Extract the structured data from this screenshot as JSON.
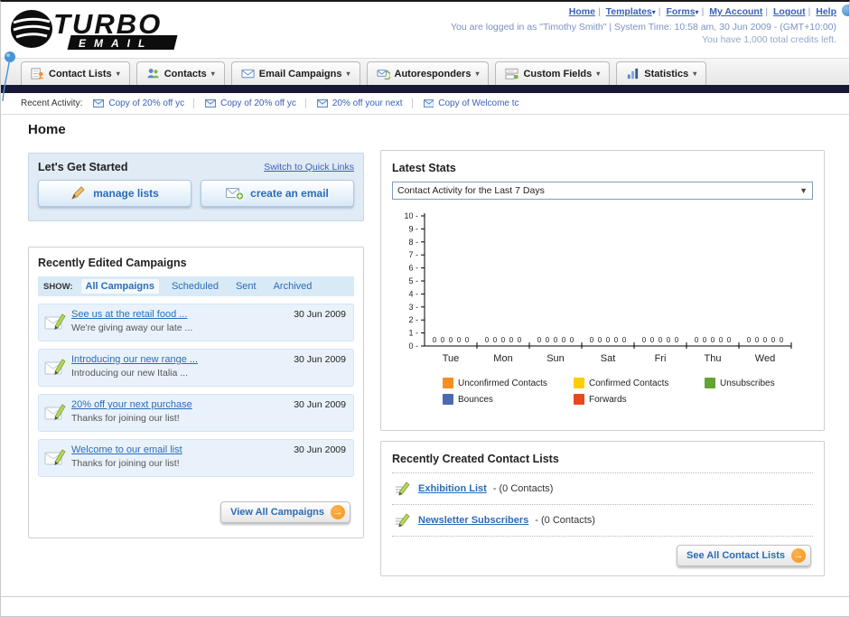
{
  "page": {
    "title": "Home"
  },
  "header": {
    "logo_top": "TURBO",
    "logo_bottom": "EMAIL",
    "nav": [
      {
        "label": "Home",
        "dropdown": false
      },
      {
        "label": "Templates",
        "dropdown": true
      },
      {
        "label": "Forms",
        "dropdown": true
      },
      {
        "label": "My Account",
        "dropdown": false
      },
      {
        "label": "Logout",
        "dropdown": false
      },
      {
        "label": "Help",
        "dropdown": false
      }
    ],
    "login_info": "You are logged in as \"Timothy Smith\" | System Time: 10:58 am, 30 Jun 2009 - (GMT+10:00)",
    "credits": "You have 1,000 total credits left."
  },
  "nav_tabs": [
    {
      "label": "Contact Lists"
    },
    {
      "label": "Contacts"
    },
    {
      "label": "Email Campaigns"
    },
    {
      "label": "Autoresponders"
    },
    {
      "label": "Custom Fields"
    },
    {
      "label": "Statistics"
    }
  ],
  "recent_activity": {
    "label": "Recent Activity:",
    "items": [
      "Copy of 20% off yc",
      "Copy of 20% off yc",
      "20% off your next",
      "Copy of Welcome tc"
    ]
  },
  "get_started": {
    "title": "Let's Get Started",
    "switch_link": "Switch to Quick Links",
    "manage_lists_label": "manage lists",
    "create_email_label": "create an email"
  },
  "campaigns": {
    "title": "Recently Edited Campaigns",
    "show_label": "SHOW:",
    "filters": [
      "All Campaigns",
      "Scheduled",
      "Sent",
      "Archived"
    ],
    "selected_filter": "All Campaigns",
    "items": [
      {
        "title": "See us at the retail food ...",
        "subtitle": "We're giving away our late ...",
        "date": "30 Jun 2009"
      },
      {
        "title": "Introducing our new range ...",
        "subtitle": "Introducing our new Italia ...",
        "date": "30 Jun 2009"
      },
      {
        "title": "20% off your next purchase",
        "subtitle": "Thanks for joining our list!",
        "date": "30 Jun 2009"
      },
      {
        "title": "Welcome to our email list",
        "subtitle": "Thanks for joining our list!",
        "date": "30 Jun 2009"
      }
    ],
    "view_all_label": "View All Campaigns"
  },
  "stats": {
    "title": "Latest Stats",
    "dropdown_value": "Contact Activity for the Last 7 Days",
    "chart_data": {
      "type": "bar",
      "title": "Contact Activity for the Last 7 Days",
      "categories": [
        "Tue",
        "Mon",
        "Sun",
        "Sat",
        "Fri",
        "Thu",
        "Wed"
      ],
      "series": [
        {
          "name": "Unconfirmed Contacts",
          "color": "#f78f1e",
          "values": [
            0,
            0,
            0,
            0,
            0,
            0,
            0
          ]
        },
        {
          "name": "Confirmed Contacts",
          "color": "#ffcc00",
          "values": [
            0,
            0,
            0,
            0,
            0,
            0,
            0
          ]
        },
        {
          "name": "Unsubscribes",
          "color": "#64a433",
          "values": [
            0,
            0,
            0,
            0,
            0,
            0,
            0
          ]
        },
        {
          "name": "Bounces",
          "color": "#4a6baf",
          "values": [
            0,
            0,
            0,
            0,
            0,
            0,
            0
          ]
        },
        {
          "name": "Forwards",
          "color": "#e8471f",
          "values": [
            0,
            0,
            0,
            0,
            0,
            0,
            0
          ]
        }
      ],
      "ylim": [
        0,
        10
      ],
      "ytick_step": 1,
      "grid": false,
      "legend_position": "bottom"
    },
    "legend": [
      {
        "label": "Unconfirmed Contacts",
        "color": "#f78f1e"
      },
      {
        "label": "Confirmed Contacts",
        "color": "#ffcc00"
      },
      {
        "label": "Unsubscribes",
        "color": "#64a433"
      },
      {
        "label": "Bounces",
        "color": "#4a6baf"
      },
      {
        "label": "Forwards",
        "color": "#e8471f"
      }
    ]
  },
  "contact_lists": {
    "title": "Recently Created Contact Lists",
    "items": [
      {
        "name": "Exhibition List",
        "detail": "- (0 Contacts)"
      },
      {
        "name": "Newsletter Subscribers",
        "detail": "- (0 Contacts)"
      }
    ],
    "see_all_label": "See All Contact Lists"
  },
  "colors": {
    "link_blue": "#2a6cb8",
    "accent_orange": "#f7941d",
    "dark_bar": "#181836",
    "panel_blue_bg": "#e1ebf5"
  }
}
